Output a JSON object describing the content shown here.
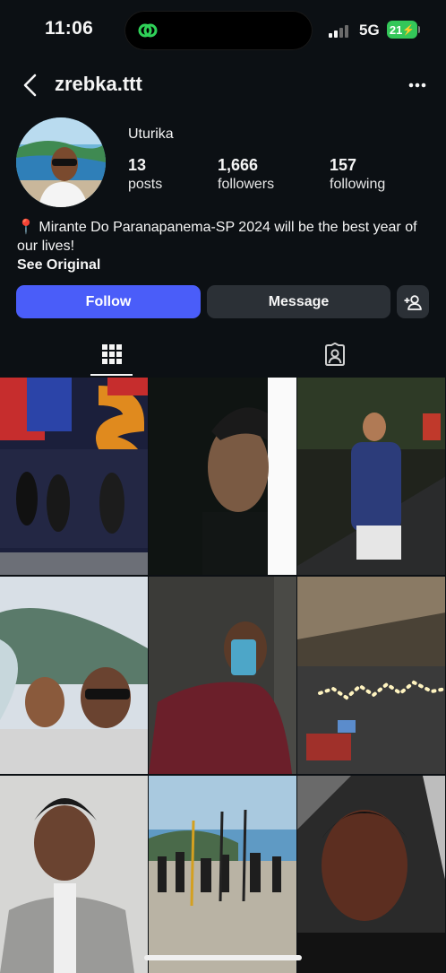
{
  "status_bar": {
    "time": "11:06",
    "network": "5G",
    "battery": "21"
  },
  "header": {
    "username": "zrebka.ttt"
  },
  "profile": {
    "display_name": "Uturika",
    "stats": [
      {
        "value": "13",
        "label": "posts"
      },
      {
        "value": "1,666",
        "label": "followers"
      },
      {
        "value": "157",
        "label": "following"
      }
    ],
    "bio": "📍 Mirante Do Paranapanema-SP 2024 will be the best year of our lives!",
    "see_original": "See Original"
  },
  "actions": {
    "follow": "Follow",
    "message": "Message"
  },
  "tabs": [
    {
      "icon": "grid-icon",
      "active": true
    },
    {
      "icon": "tagged-photos-icon",
      "active": false
    }
  ],
  "colors": {
    "background": "#0c1014",
    "follow_button": "#4a5df9",
    "secondary_button": "#2b3036",
    "battery": "#34c759"
  },
  "grid_posts": [
    "group photo in front of colorful letters",
    "close-up portrait at night",
    "man in navy polo at night",
    "selfie of two men on scenic overlook",
    "mirror selfie with phone",
    "room with string lights",
    "child portrait in suit",
    "group with paddles on beach",
    "close-up selfie"
  ]
}
